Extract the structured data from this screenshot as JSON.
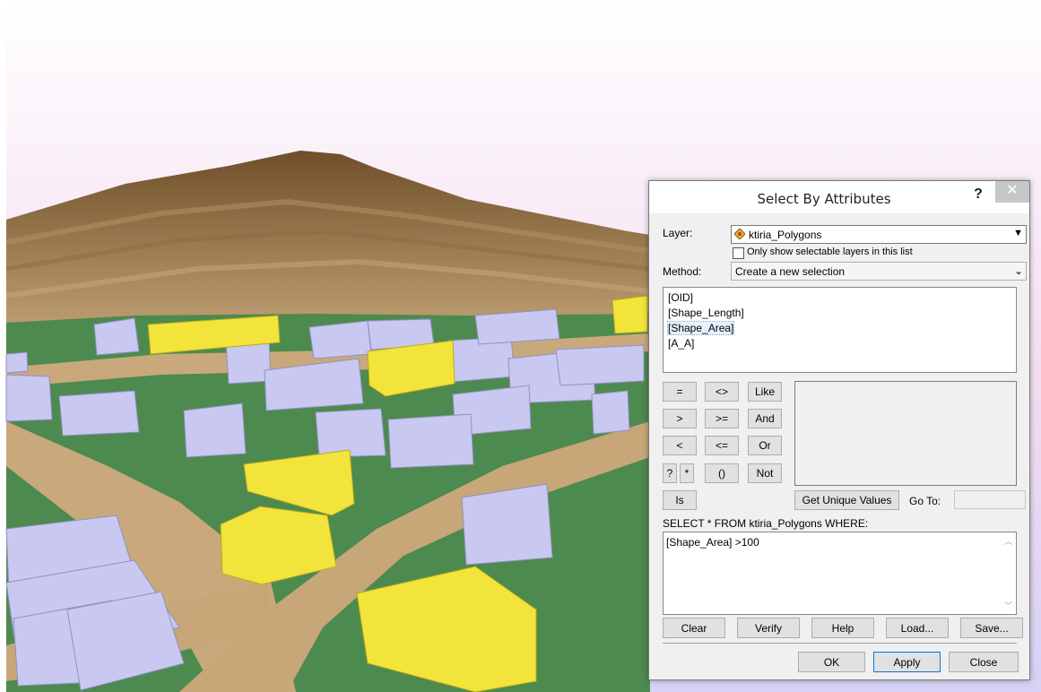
{
  "dialog": {
    "title": "Select By Attributes",
    "help_label": "?",
    "close_label": "✕",
    "layer_label": "Layer:",
    "layer_value": "ktiria_Polygons",
    "only_selectable_label": "Only show selectable layers in this list",
    "method_label": "Method:",
    "method_value": "Create a new selection",
    "fields": [
      "[OID]",
      "[Shape_Length]",
      "[Shape_Area]",
      "[A_A]"
    ],
    "operators": {
      "eq": "=",
      "ne": "<>",
      "like": "Like",
      "gt": ">",
      "ge": ">=",
      "and": "And",
      "lt": "<",
      "le": "<=",
      "or": "Or",
      "q": "?",
      "star": "*",
      "paren": "()",
      "not": "Not",
      "is": "Is"
    },
    "get_unique_values": "Get Unique Values",
    "go_to_label": "Go To:",
    "select_from": "SELECT * FROM ktiria_Polygons WHERE:",
    "expression": "[Shape_Area] >100",
    "buttons": {
      "clear": "Clear",
      "verify": "Verify",
      "help": "Help",
      "load": "Load...",
      "save": "Save...",
      "ok": "OK",
      "apply": "Apply",
      "close": "Close"
    }
  },
  "colors": {
    "sky_top": "#ffffff",
    "sky_bottom": "#d9d3f5",
    "hill": "#9c7a4e",
    "ground": "#4f8a4f",
    "road": "#c7a77a",
    "building": "#c4c4ec",
    "selected_building": "#f0e442"
  }
}
